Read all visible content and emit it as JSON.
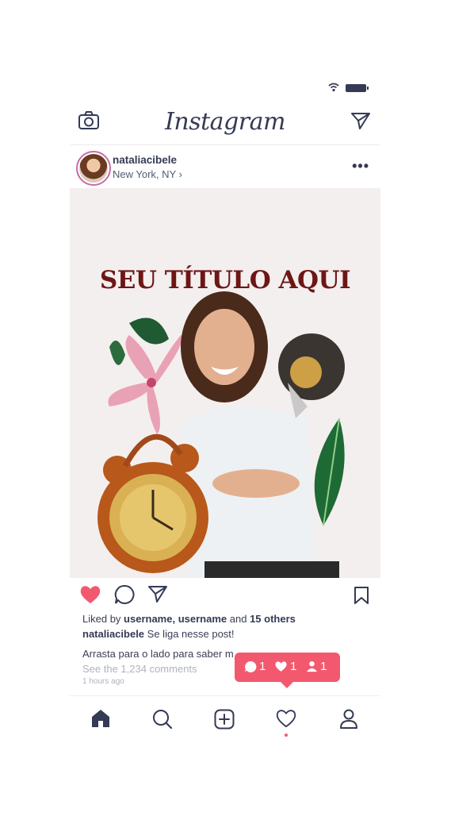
{
  "app": {
    "name": "Instagram"
  },
  "post": {
    "username": "nataliacibele",
    "location": "New York, NY",
    "location_chevron": "›",
    "more_label": "•••",
    "image_title": "SEU TÍTULO AQUI"
  },
  "likes": {
    "prefix": "Liked by",
    "users": "username, username",
    "middle": "and",
    "others": "15 others"
  },
  "caption": {
    "username": "nataliacibele",
    "text": "Se liga nesse post!",
    "line2": "Arrasta para o lado para saber m"
  },
  "comments_link": "See the 1,234 comments",
  "time": "1 hours ago",
  "notification": {
    "comments": "1",
    "likes": "1",
    "follows": "1"
  },
  "icons": {
    "camera": "camera-icon",
    "direct": "send-icon",
    "heart": "heart-icon",
    "comment": "comment-icon",
    "share": "send-icon",
    "bookmark": "bookmark-icon",
    "home": "home-icon",
    "search": "search-icon",
    "add": "add-icon",
    "activity": "heart-outline-icon",
    "profile": "profile-icon"
  },
  "colors": {
    "accent": "#f2596f",
    "ink": "#353a55",
    "title": "#6d1616",
    "image_bg": "#f3efee"
  }
}
